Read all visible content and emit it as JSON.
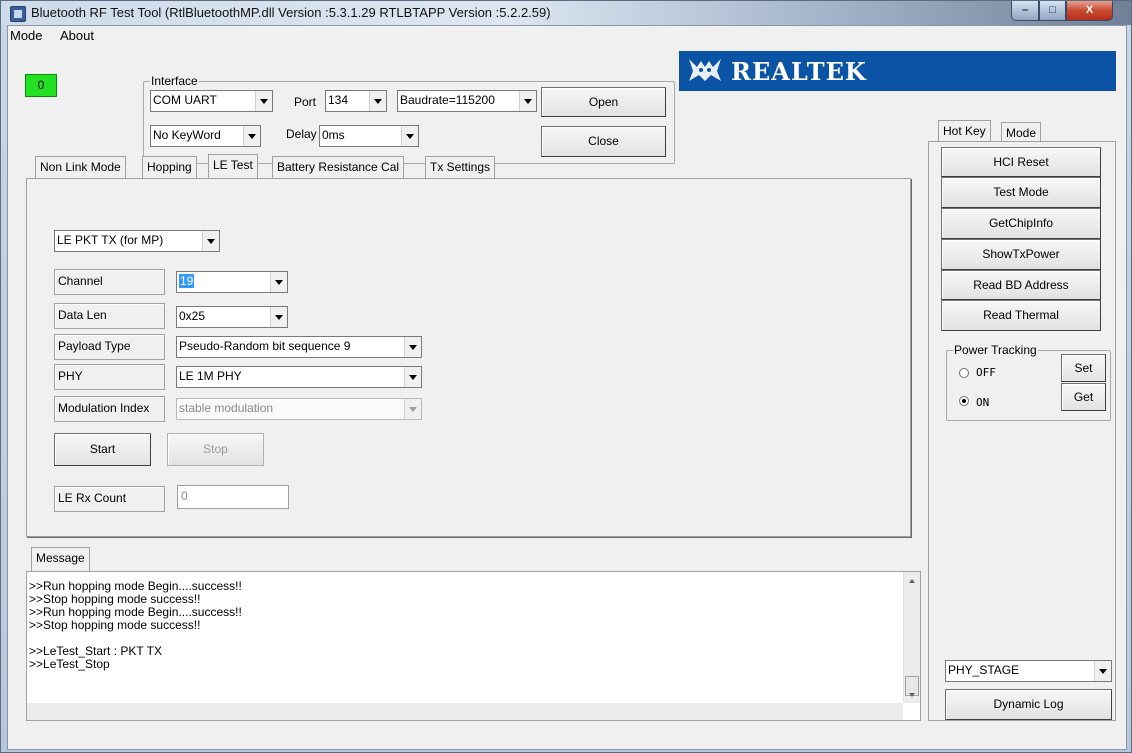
{
  "window": {
    "title": "Bluetooth RF Test Tool (RtlBluetoothMP.dll Version :5.3.1.29   RTLBTAPP Version :5.2.2.59)",
    "min_glyph": "–",
    "max_glyph": "□",
    "close_glyph": "X"
  },
  "menu": {
    "mode": "Mode",
    "about": "About"
  },
  "status_led": "0",
  "interface": {
    "legend": "Interface",
    "connection": "COM UART",
    "port_label": "Port",
    "port": "134",
    "baudrate": "Baudrate=115200",
    "keyword": "No KeyWord",
    "delay_label": "Delay",
    "delay": "0ms",
    "open_label": "Open",
    "close_label": "Close"
  },
  "logo": {
    "text": "REALTEK"
  },
  "tabs": [
    {
      "label": "Non Link Mode"
    },
    {
      "label": "Hopping"
    },
    {
      "label": "LE Test"
    },
    {
      "label": "Battery Resistance Cal"
    },
    {
      "label": "Tx Settings"
    }
  ],
  "le_test": {
    "mode": "LE PKT TX (for MP)",
    "channel_label": "Channel",
    "channel": "19",
    "data_len_label": "Data Len",
    "data_len": "0x25",
    "payload_label": "Payload Type",
    "payload": "Pseudo-Random bit sequence 9",
    "phy_label": "PHY",
    "phy": "LE 1M PHY",
    "modulation_label": "Modulation Index",
    "modulation": "stable modulation",
    "start_label": "Start",
    "stop_label": "Stop",
    "rx_count_label": "LE Rx Count",
    "rx_count": "0"
  },
  "message": {
    "tab_label": "Message",
    "lines": [
      ">>Run hopping mode Begin....success!!",
      ">>Stop hopping mode success!!",
      ">>Run hopping mode Begin....success!!",
      ">>Stop hopping mode success!!",
      "",
      ">>LeTest_Start : PKT TX",
      ">>LeTest_Stop"
    ]
  },
  "side": {
    "tabs": [
      {
        "label": "Hot Key"
      },
      {
        "label": "Mode"
      }
    ],
    "buttons": [
      {
        "label": "HCI Reset"
      },
      {
        "label": "Test Mode"
      },
      {
        "label": "GetChipInfo"
      },
      {
        "label": "ShowTxPower"
      },
      {
        "label": "Read BD Address"
      },
      {
        "label": "Read Thermal"
      }
    ],
    "power_tracking": {
      "legend": "Power Tracking",
      "off_label": "OFF",
      "on_label": "ON",
      "selected": "ON",
      "set_label": "Set",
      "get_label": "Get"
    },
    "log_stage": "PHY_STAGE",
    "dynamic_log_label": "Dynamic Log"
  },
  "colors": {
    "status_led": "#22e022",
    "logo_banner": "#0b53a5",
    "selection": "#3399ff"
  }
}
